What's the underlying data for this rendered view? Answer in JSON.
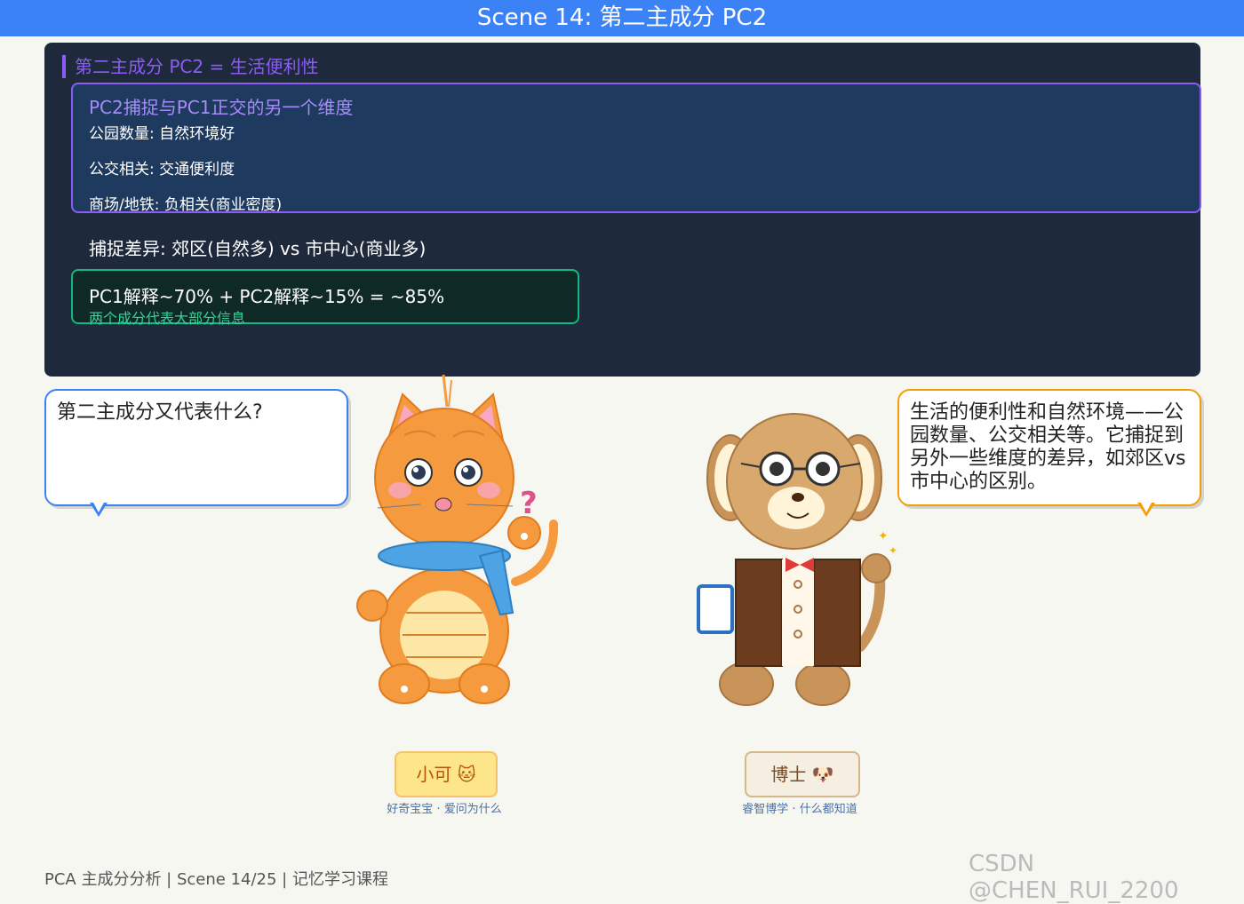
{
  "header": {
    "title": "Scene 14: 第二主成分 PC2"
  },
  "panel": {
    "heading": "第二主成分 PC2 = 生活便利性",
    "info_box": {
      "title": "PC2捕捉与PC1正交的另一个维度",
      "lines": [
        "公园数量: 自然环境好",
        "公交相关: 交通便利度",
        "商场/地铁: 负相关(商业密度)"
      ]
    },
    "difference": "捕捉差异: 郊区(自然多) vs 市中心(商业多)",
    "summary": {
      "main": "PC1解释~70% + PC2解释~15% = ~85%",
      "sub": "两个成分代表大部分信息"
    }
  },
  "dialog": {
    "left_bubble": "第二主成分又代表什么?",
    "right_bubble": "生活的便利性和自然环境——公园数量、公交相关等。它捕捉到另外一些维度的差异，如郊区vs市中心的区别。"
  },
  "characters": {
    "cat": {
      "name": "小可 🐱",
      "subtitle": "好奇宝宝 · 爱问为什么"
    },
    "dog": {
      "name": "博士 🐶",
      "subtitle": "睿智博学 · 什么都知道"
    }
  },
  "footer": {
    "text": "PCA 主成分分析 | Scene 14/25 | 记忆学习课程"
  },
  "watermark": "CSDN @CHEN_RUI_2200",
  "colors": {
    "title_bar": "#3b82f6",
    "panel_bg": "#1e293b",
    "accent_purple": "#8b5cf6",
    "accent_green": "#10b981",
    "bubble_left_border": "#3b82f6",
    "bubble_right_border": "#f59e0b"
  }
}
